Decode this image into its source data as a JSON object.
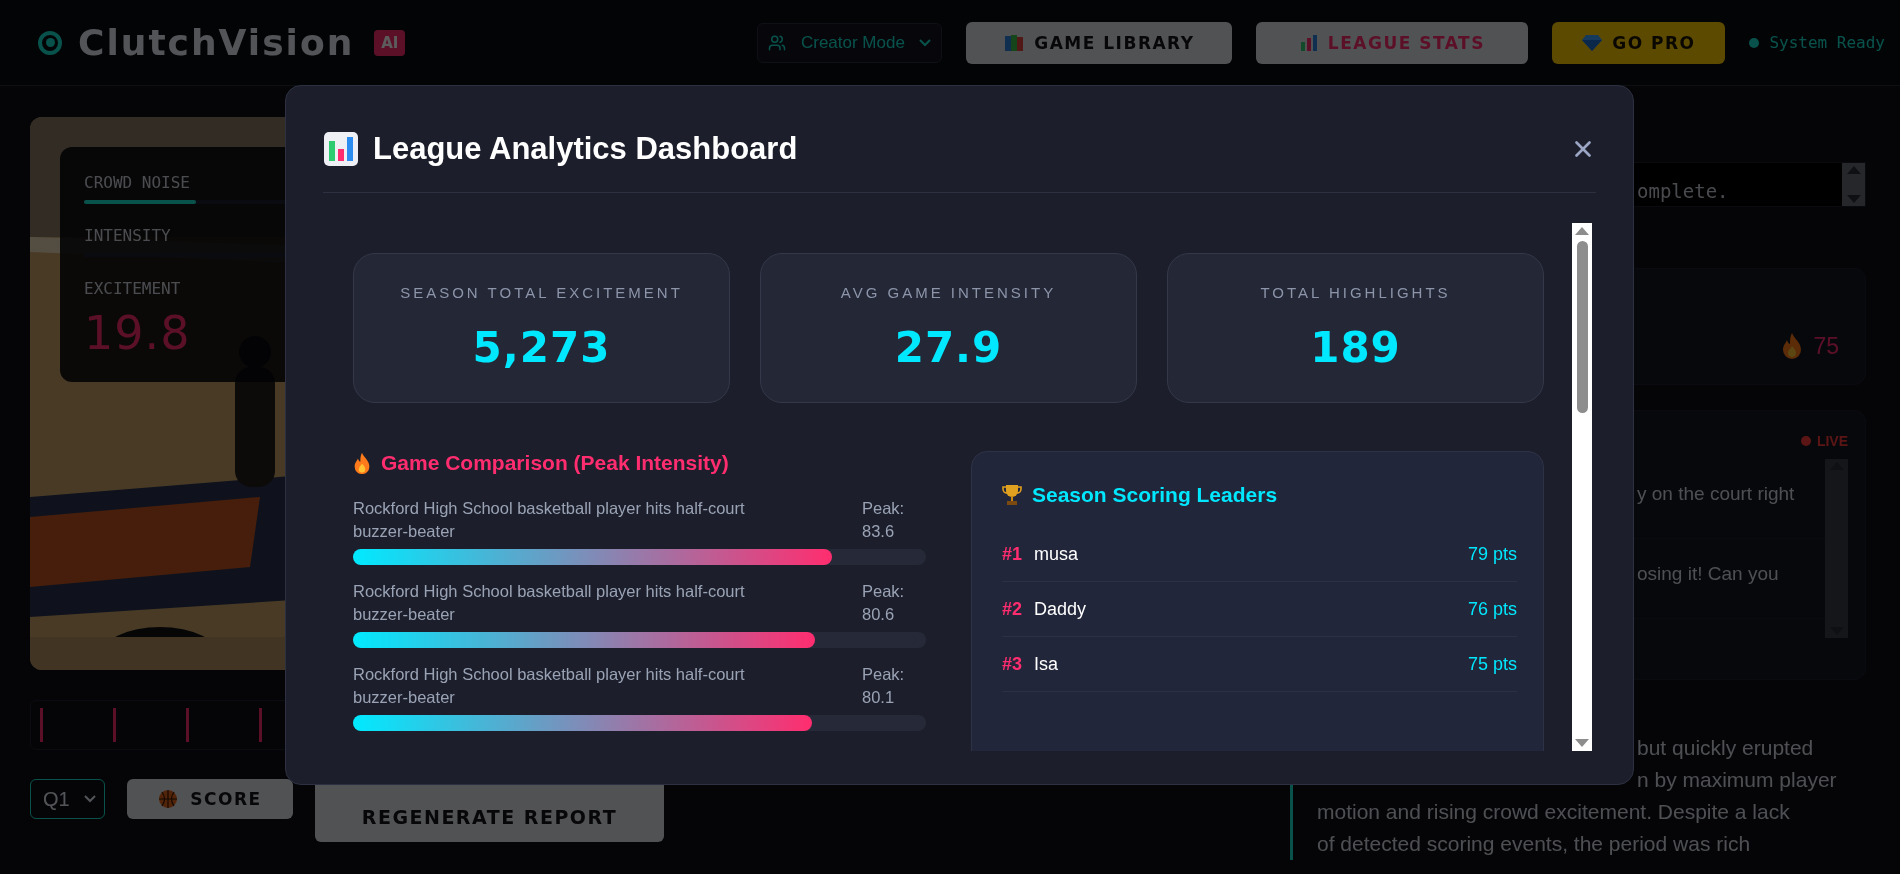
{
  "header": {
    "logo": "ClutchVision",
    "badge": "AI",
    "mode_select": {
      "value": "Creator Mode"
    },
    "nav_buttons": [
      {
        "label": "GAME LIBRARY",
        "kind": "library"
      },
      {
        "label": "LEAGUE STATS",
        "kind": "stats"
      },
      {
        "label": "GO PRO",
        "kind": "pro"
      }
    ],
    "status": {
      "label": "System Ready",
      "on": true
    }
  },
  "video_panel": {
    "meters": [
      {
        "label": "CROWD NOISE",
        "level": 0.35
      },
      {
        "label": "INTENSITY"
      }
    ],
    "excitement": {
      "label": "EXCITEMENT",
      "value": "19.8"
    },
    "quarter_select": {
      "value": "Q1"
    },
    "score_button": "SCORE",
    "regenerate_button": "REGENERATE REPORT"
  },
  "side_panel": {
    "log_text": "omplete.",
    "intensity_value": "75",
    "live_badge": "LIVE",
    "messages": [
      "y on the court right",
      "osing it! Can you"
    ],
    "summary_lines": [
      {
        "text": "but quickly erupted",
        "kind": "clipped"
      },
      {
        "text": "n by maximum player",
        "kind": "clipped"
      },
      {
        "text": "motion and rising crowd excitement. Despite a lack",
        "kind": "full"
      },
      {
        "text": "of detected scoring events, the period was rich",
        "kind": "full"
      }
    ]
  },
  "modal": {
    "title": "League Analytics Dashboard",
    "stats": [
      {
        "label": "SEASON TOTAL EXCITEMENT",
        "value": "5,273"
      },
      {
        "label": "AVG GAME INTENSITY",
        "value": "27.9"
      },
      {
        "label": "TOTAL HIGHLIGHTS",
        "value": "189"
      }
    ],
    "comparison": {
      "title": "Game Comparison (Peak Intensity)",
      "games": [
        {
          "name": "Rockford High School basketball player hits half-court buzzer-beater",
          "peak": "Peak: 83.6",
          "level": 0.836
        },
        {
          "name": "Rockford High School basketball player hits half-court buzzer-beater",
          "peak": "Peak: 80.6",
          "level": 0.806
        },
        {
          "name": "Rockford High School basketball player hits half-court buzzer-beater",
          "peak": "Peak: 80.1",
          "level": 0.801
        }
      ]
    },
    "leaders": {
      "title": "Season Scoring Leaders",
      "rows": [
        {
          "rank": "#1",
          "name": "musa",
          "points": "79 pts"
        },
        {
          "rank": "#2",
          "name": "Daddy",
          "points": "76 pts"
        },
        {
          "rank": "#3",
          "name": "Isa",
          "points": "75 pts"
        }
      ]
    }
  }
}
